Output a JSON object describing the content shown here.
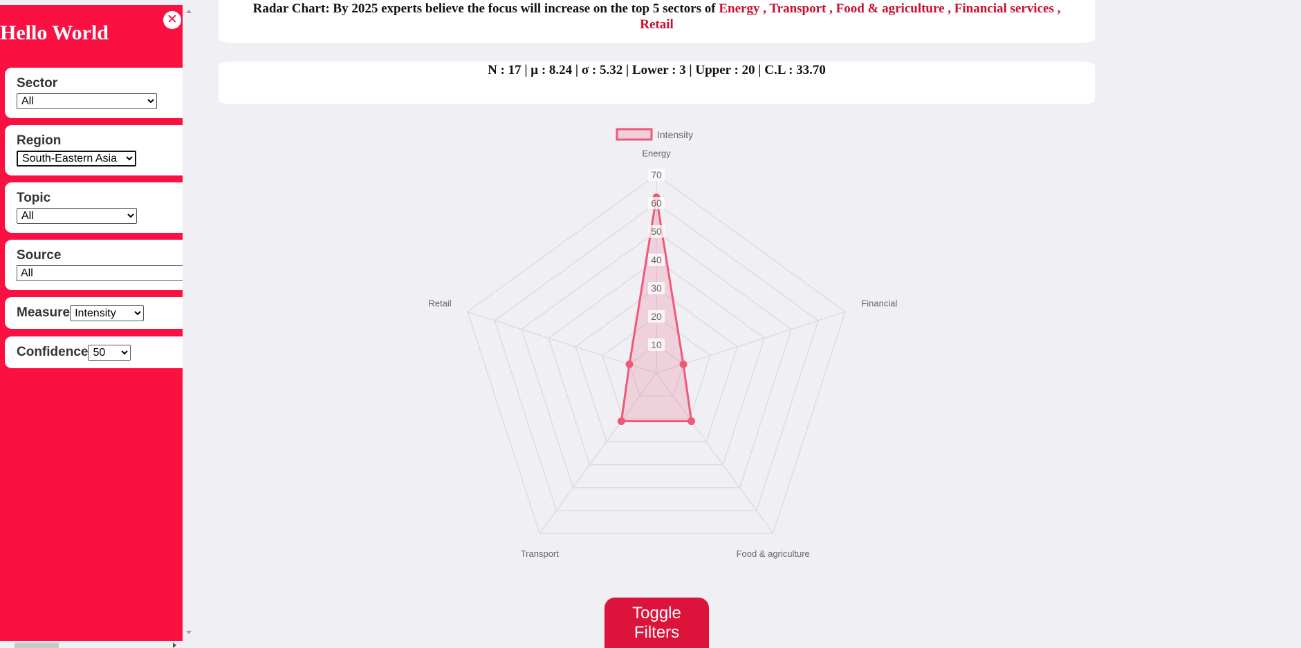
{
  "sidebar": {
    "title": "Hello World",
    "filters": [
      {
        "label": "Sector",
        "value": "All"
      },
      {
        "label": "Region",
        "value": "South-Eastern Asia"
      },
      {
        "label": "Topic",
        "value": "All"
      },
      {
        "label": "Source",
        "value": "All"
      },
      {
        "label": "Measure",
        "value": "Intensity"
      },
      {
        "label": "Confidence",
        "value": "50"
      }
    ]
  },
  "header": {
    "title_prefix": "Radar Chart: By 2025 experts believe the focus will increase on the top 5 sectors of",
    "sectors": [
      "Energy",
      "Transport",
      "Food & agriculture",
      "Financial services",
      "Retail"
    ],
    "separator": " , "
  },
  "stats": "N : 17 | μ : 8.24 | σ : 5.32 | Lower : 3 | Upper : 20 | C.L : 33.70",
  "toggle_label": "Toggle Filters",
  "colors": {
    "accent": "#fb1042",
    "series_stroke": "#f0587a",
    "series_fill": "rgba(240,88,122,0.2)",
    "button": "#dc143c"
  },
  "chart_data": {
    "type": "radar",
    "categories": [
      "Energy",
      "Financial services",
      "Food & agriculture",
      "Transport",
      "Retail"
    ],
    "series": [
      {
        "name": "Intensity",
        "values": [
          62,
          10,
          21,
          21,
          10
        ]
      }
    ],
    "ticks": [
      10,
      20,
      30,
      40,
      50,
      60,
      70
    ],
    "rlim": [
      0,
      70
    ],
    "legend": "top",
    "grid": true
  }
}
